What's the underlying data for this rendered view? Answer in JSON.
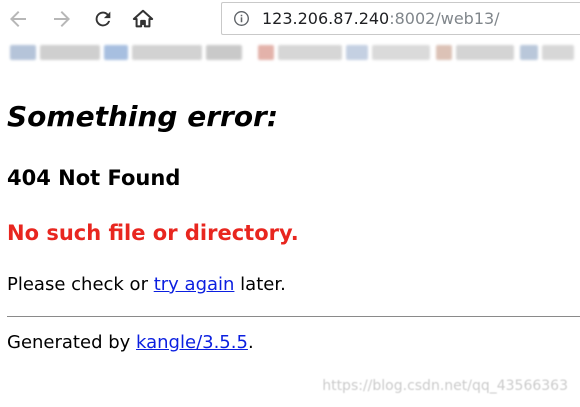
{
  "browser": {
    "url_host": "123.206.87.240",
    "url_rest": ":8002/web13/",
    "icons": {
      "back": "back-arrow-icon",
      "forward": "forward-arrow-icon",
      "reload": "reload-icon",
      "home": "home-icon",
      "site_info": "info-icon"
    }
  },
  "bookmarks_bar": {
    "blurred": true,
    "colors": [
      "#9fb6d6",
      "#c7c7c7",
      "#e0a19a",
      "#b9b9b9",
      "#d9c3b8",
      "#a8b8cc",
      "#c2c2c2",
      "#d8d8d8"
    ]
  },
  "error_page": {
    "heading": "Something error:",
    "status": "404 Not Found",
    "message": "No such file or directory.",
    "hint_before": "Please check or ",
    "hint_link": "try again",
    "hint_after": " later.",
    "footer_before": "Generated by ",
    "footer_link": "kangle/3.5.5",
    "footer_after": ".",
    "message_color": "#e8261f",
    "link_color": "#0b1fe0"
  },
  "watermark": {
    "text": "https://blog.csdn.net/qq_43566363"
  }
}
